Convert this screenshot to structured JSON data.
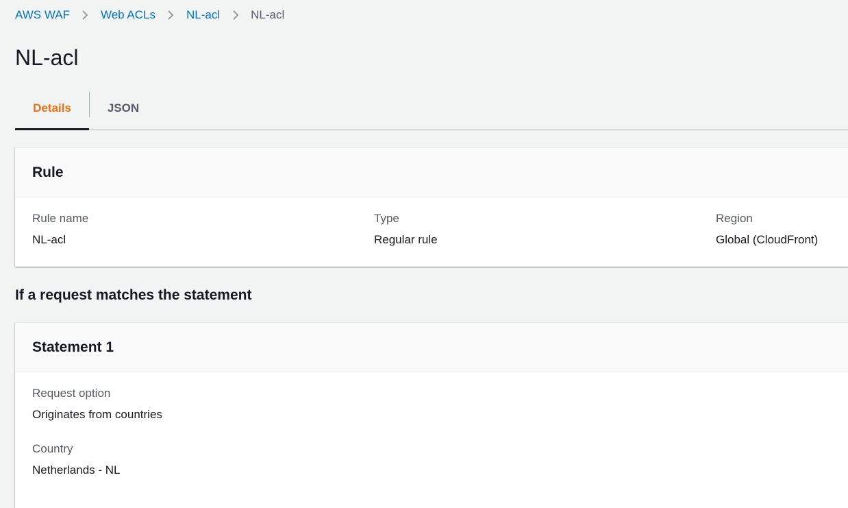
{
  "breadcrumb": {
    "items": [
      "AWS WAF",
      "Web ACLs",
      "NL-acl"
    ],
    "current": "NL-acl"
  },
  "page": {
    "title": "NL-acl"
  },
  "tabs": [
    {
      "label": "Details",
      "active": true
    },
    {
      "label": "JSON",
      "active": false
    }
  ],
  "rule_card": {
    "title": "Rule",
    "fields": [
      {
        "label": "Rule name",
        "value": "NL-acl"
      },
      {
        "label": "Type",
        "value": "Regular rule"
      },
      {
        "label": "Region",
        "value": "Global (CloudFront)"
      }
    ]
  },
  "section": {
    "heading": "If a request matches the statement"
  },
  "statement_card": {
    "title": "Statement 1",
    "fields": [
      {
        "label": "Request option",
        "value": "Originates from countries"
      },
      {
        "label": "Country",
        "value": "Netherlands - NL"
      }
    ]
  },
  "colors": {
    "link": "#0073bb",
    "active_tab": "#ec7211",
    "text": "#16191f",
    "muted": "#545b64",
    "background": "#f2f3f3"
  },
  "icons": {
    "separator": "chevron-right-icon"
  }
}
